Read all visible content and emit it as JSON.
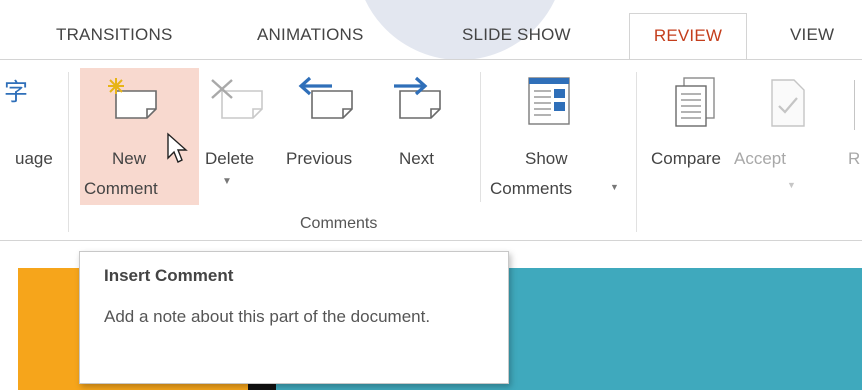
{
  "tabs": [
    {
      "label": "TRANSITIONS"
    },
    {
      "label": "ANIMATIONS"
    },
    {
      "label": "SLIDE SHOW"
    },
    {
      "label": "REVIEW"
    },
    {
      "label": "VIEW"
    }
  ],
  "ribbon": {
    "language_partial": "uage",
    "language_glyph": "字",
    "new_comment": {
      "line1": "New",
      "line2": "Comment"
    },
    "delete": "Delete",
    "previous": "Previous",
    "next": "Next",
    "show_comments": {
      "line1": "Show",
      "line2": "Comments"
    },
    "comments_group": "Comments",
    "compare": "Compare",
    "accept": "Accept",
    "reject_partial": "R"
  },
  "tooltip": {
    "title": "Insert Comment",
    "description": "Add a note about this part of the document."
  },
  "colors": {
    "review_tab_text": "#c43e1c",
    "hover_highlight": "#f8d9cf",
    "slide_orange": "#f6a51b",
    "slide_teal": "#3fa9bd"
  }
}
